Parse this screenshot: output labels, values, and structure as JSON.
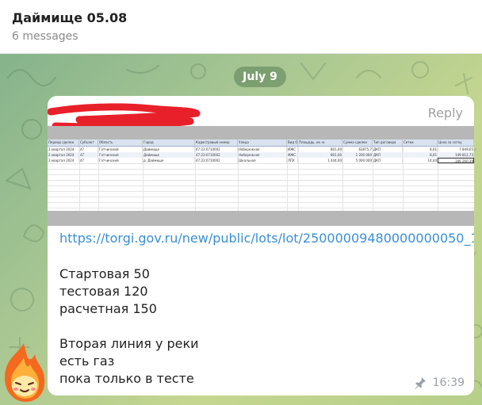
{
  "header": {
    "title": "Даймище 05.08",
    "subtitle": "6 messages"
  },
  "date_pill": "July 9",
  "message": {
    "reply_label": "Reply",
    "link": "https://torgi.gov.ru/new/public/lots/lot/25000009480000000050_1",
    "lines": [
      "Стартовая 50",
      "тестовая 120",
      "расчетная 150",
      "",
      "Вторая линия у реки",
      "есть газ",
      "пока только в тесте"
    ],
    "time": "16:39",
    "pin_icon": "pin-icon"
  },
  "spreadsheet": {
    "headers": [
      "Период сделки",
      "Субъект",
      "Область",
      "Город",
      "Кадастровый номер",
      "Улица",
      "Вид ОП",
      "Площадь, кв. м.",
      "Сумма сделки",
      "Тип договора",
      "Сетки",
      "Цена за сотку"
    ],
    "rows": [
      [
        "1 квартал 2024",
        "47",
        "Гатчинский",
        "Даймище",
        "47:23:0710002",
        "Набережная",
        "ИЖС",
        "801,00",
        "62875,7",
        "ДКП",
        "8,01",
        "7 849,65"
      ],
      [
        "2 квартал 2024",
        "47",
        "Гатчинский",
        "Даймище",
        "47:23:0710002",
        "Набережная",
        "ИЖС",
        "801,00",
        "1 200 000",
        "ДКП",
        "8,01",
        "149 812,73"
      ],
      [
        "3 квартал 2024",
        "47",
        "Гатчинский",
        "д. Даймище",
        "47:23:0710002",
        "Школьная",
        "ЛПХ",
        "1 444,00",
        "5 000 000",
        "ДКП",
        "14,44",
        "346 260,39"
      ]
    ]
  },
  "icons": {
    "avatar": "fire-mascot-avatar",
    "redaction": "red-redaction-scribble"
  },
  "colors": {
    "link": "#3a8fd6",
    "date_pill_bg": "#5d8a5f",
    "redaction": "#e8202a"
  }
}
